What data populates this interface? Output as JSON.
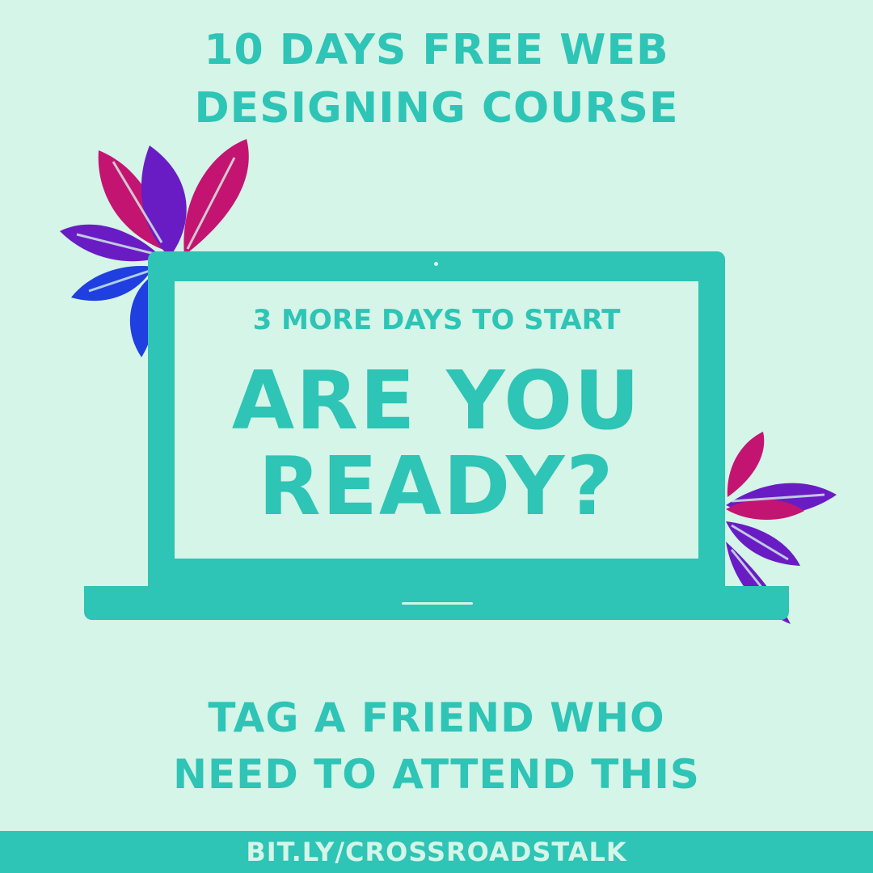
{
  "header": {
    "line1": "10 DAYS FREE WEB",
    "line2": "DESIGNING COURSE"
  },
  "screen": {
    "subtitle": "3 MORE DAYS TO START",
    "headline_line1": "ARE YOU",
    "headline_line2": "READY?"
  },
  "call_to_action": {
    "line1": "TAG A FRIEND WHO",
    "line2": "NEED TO ATTEND THIS"
  },
  "footer": {
    "link": "BIT.LY/CROSSROADSTALK"
  },
  "colors": {
    "background": "#d4f5e7",
    "accent": "#2ec4b6",
    "leaf_pink": "#c41472",
    "leaf_purple": "#6a1cc4",
    "leaf_blue": "#1f3fe0"
  }
}
